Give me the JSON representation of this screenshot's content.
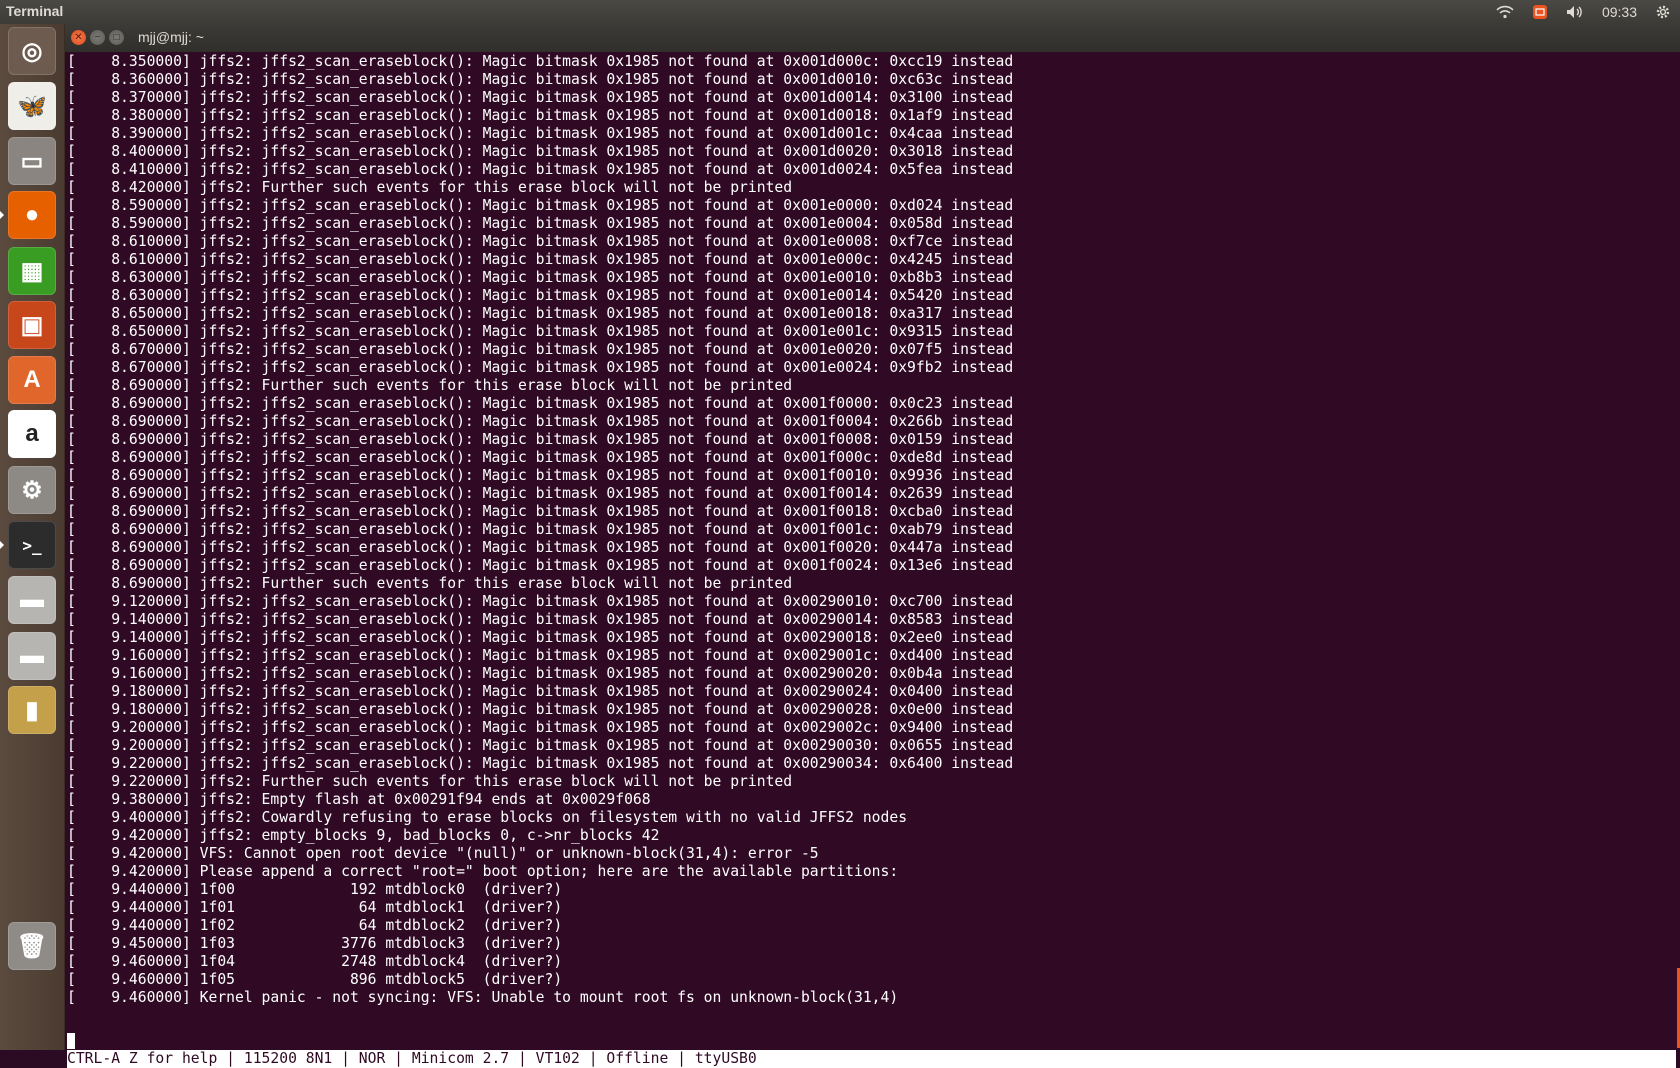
{
  "topbar": {
    "app_title": "Terminal",
    "clock": "09:33"
  },
  "icons": {
    "wifi": "wifi-icon",
    "input_method": "keyboard-indicator-icon",
    "volume": "volume-icon",
    "settings": "gear-icon"
  },
  "colors": {
    "terminal_bg": "#300a24",
    "terminal_fg": "#ffffff",
    "accent": "#e95420",
    "panel": "#3c3b37"
  },
  "launcher": {
    "items": [
      {
        "name": "dash-home",
        "glyph": "◎",
        "color": "#6d5b4f"
      },
      {
        "name": "shotwell",
        "glyph": "🦋",
        "color": "#f0eee9"
      },
      {
        "name": "files",
        "glyph": "▭",
        "color": "#8a8580"
      },
      {
        "name": "firefox",
        "glyph": "●",
        "color": "#e66000"
      },
      {
        "name": "libreoffice-calc",
        "glyph": "▦",
        "color": "#3a9d23"
      },
      {
        "name": "libreoffice-impress",
        "glyph": "▣",
        "color": "#c7471b"
      },
      {
        "name": "ubuntu-software-center",
        "glyph": "A",
        "color": "#e0662b"
      },
      {
        "name": "amazon",
        "glyph": "a",
        "color": "#ffffff"
      },
      {
        "name": "system-settings",
        "glyph": "⚙",
        "color": "#8d8a85"
      },
      {
        "name": "terminal",
        "glyph": ">_",
        "color": "#2c2c2c"
      },
      {
        "name": "drive-1",
        "glyph": "▬",
        "color": "#b7b5b1"
      },
      {
        "name": "drive-2",
        "glyph": "▬",
        "color": "#b7b5b1"
      },
      {
        "name": "sd-card",
        "glyph": "▮",
        "color": "#c5a04a"
      },
      {
        "name": "trash",
        "glyph": "🗑",
        "color": "#8f8c88"
      }
    ]
  },
  "window": {
    "title": "mjj@mjj: ~"
  },
  "terminal": {
    "lines": [
      "[    8.350000] jffs2: jffs2_scan_eraseblock(): Magic bitmask 0x1985 not found at 0x001d000c: 0xcc19 instead",
      "[    8.360000] jffs2: jffs2_scan_eraseblock(): Magic bitmask 0x1985 not found at 0x001d0010: 0xc63c instead",
      "[    8.370000] jffs2: jffs2_scan_eraseblock(): Magic bitmask 0x1985 not found at 0x001d0014: 0x3100 instead",
      "[    8.380000] jffs2: jffs2_scan_eraseblock(): Magic bitmask 0x1985 not found at 0x001d0018: 0x1af9 instead",
      "[    8.390000] jffs2: jffs2_scan_eraseblock(): Magic bitmask 0x1985 not found at 0x001d001c: 0x4caa instead",
      "[    8.400000] jffs2: jffs2_scan_eraseblock(): Magic bitmask 0x1985 not found at 0x001d0020: 0x3018 instead",
      "[    8.410000] jffs2: jffs2_scan_eraseblock(): Magic bitmask 0x1985 not found at 0x001d0024: 0x5fea instead",
      "[    8.420000] jffs2: Further such events for this erase block will not be printed",
      "[    8.590000] jffs2: jffs2_scan_eraseblock(): Magic bitmask 0x1985 not found at 0x001e0000: 0xd024 instead",
      "[    8.590000] jffs2: jffs2_scan_eraseblock(): Magic bitmask 0x1985 not found at 0x001e0004: 0x058d instead",
      "[    8.610000] jffs2: jffs2_scan_eraseblock(): Magic bitmask 0x1985 not found at 0x001e0008: 0xf7ce instead",
      "[    8.610000] jffs2: jffs2_scan_eraseblock(): Magic bitmask 0x1985 not found at 0x001e000c: 0x4245 instead",
      "[    8.630000] jffs2: jffs2_scan_eraseblock(): Magic bitmask 0x1985 not found at 0x001e0010: 0xb8b3 instead",
      "[    8.630000] jffs2: jffs2_scan_eraseblock(): Magic bitmask 0x1985 not found at 0x001e0014: 0x5420 instead",
      "[    8.650000] jffs2: jffs2_scan_eraseblock(): Magic bitmask 0x1985 not found at 0x001e0018: 0xa317 instead",
      "[    8.650000] jffs2: jffs2_scan_eraseblock(): Magic bitmask 0x1985 not found at 0x001e001c: 0x9315 instead",
      "[    8.670000] jffs2: jffs2_scan_eraseblock(): Magic bitmask 0x1985 not found at 0x001e0020: 0x07f5 instead",
      "[    8.670000] jffs2: jffs2_scan_eraseblock(): Magic bitmask 0x1985 not found at 0x001e0024: 0x9fb2 instead",
      "[    8.690000] jffs2: Further such events for this erase block will not be printed",
      "[    8.690000] jffs2: jffs2_scan_eraseblock(): Magic bitmask 0x1985 not found at 0x001f0000: 0x0c23 instead",
      "[    8.690000] jffs2: jffs2_scan_eraseblock(): Magic bitmask 0x1985 not found at 0x001f0004: 0x266b instead",
      "[    8.690000] jffs2: jffs2_scan_eraseblock(): Magic bitmask 0x1985 not found at 0x001f0008: 0x0159 instead",
      "[    8.690000] jffs2: jffs2_scan_eraseblock(): Magic bitmask 0x1985 not found at 0x001f000c: 0xde8d instead",
      "[    8.690000] jffs2: jffs2_scan_eraseblock(): Magic bitmask 0x1985 not found at 0x001f0010: 0x9936 instead",
      "[    8.690000] jffs2: jffs2_scan_eraseblock(): Magic bitmask 0x1985 not found at 0x001f0014: 0x2639 instead",
      "[    8.690000] jffs2: jffs2_scan_eraseblock(): Magic bitmask 0x1985 not found at 0x001f0018: 0xcba0 instead",
      "[    8.690000] jffs2: jffs2_scan_eraseblock(): Magic bitmask 0x1985 not found at 0x001f001c: 0xab79 instead",
      "[    8.690000] jffs2: jffs2_scan_eraseblock(): Magic bitmask 0x1985 not found at 0x001f0020: 0x447a instead",
      "[    8.690000] jffs2: jffs2_scan_eraseblock(): Magic bitmask 0x1985 not found at 0x001f0024: 0x13e6 instead",
      "[    8.690000] jffs2: Further such events for this erase block will not be printed",
      "[    9.120000] jffs2: jffs2_scan_eraseblock(): Magic bitmask 0x1985 not found at 0x00290010: 0xc700 instead",
      "[    9.140000] jffs2: jffs2_scan_eraseblock(): Magic bitmask 0x1985 not found at 0x00290014: 0x8583 instead",
      "[    9.140000] jffs2: jffs2_scan_eraseblock(): Magic bitmask 0x1985 not found at 0x00290018: 0x2ee0 instead",
      "[    9.160000] jffs2: jffs2_scan_eraseblock(): Magic bitmask 0x1985 not found at 0x0029001c: 0xd400 instead",
      "[    9.160000] jffs2: jffs2_scan_eraseblock(): Magic bitmask 0x1985 not found at 0x00290020: 0x0b4a instead",
      "[    9.180000] jffs2: jffs2_scan_eraseblock(): Magic bitmask 0x1985 not found at 0x00290024: 0x0400 instead",
      "[    9.180000] jffs2: jffs2_scan_eraseblock(): Magic bitmask 0x1985 not found at 0x00290028: 0x0e00 instead",
      "[    9.200000] jffs2: jffs2_scan_eraseblock(): Magic bitmask 0x1985 not found at 0x0029002c: 0x9400 instead",
      "[    9.200000] jffs2: jffs2_scan_eraseblock(): Magic bitmask 0x1985 not found at 0x00290030: 0x0655 instead",
      "[    9.220000] jffs2: jffs2_scan_eraseblock(): Magic bitmask 0x1985 not found at 0x00290034: 0x6400 instead",
      "[    9.220000] jffs2: Further such events for this erase block will not be printed",
      "[    9.380000] jffs2: Empty flash at 0x00291f94 ends at 0x0029f068",
      "[    9.400000] jffs2: Cowardly refusing to erase blocks on filesystem with no valid JFFS2 nodes",
      "[    9.420000] jffs2: empty_blocks 9, bad_blocks 0, c->nr_blocks 42",
      "[    9.420000] VFS: Cannot open root device \"(null)\" or unknown-block(31,4): error -5",
      "[    9.420000] Please append a correct \"root=\" boot option; here are the available partitions:",
      "[    9.440000] 1f00             192 mtdblock0  (driver?)",
      "[    9.440000] 1f01              64 mtdblock1  (driver?)",
      "[    9.440000] 1f02              64 mtdblock2  (driver?)",
      "[    9.450000] 1f03            3776 mtdblock3  (driver?)",
      "[    9.460000] 1f04            2748 mtdblock4  (driver?)",
      "[    9.460000] 1f05             896 mtdblock5  (driver?)",
      "[    9.460000] Kernel panic - not syncing: VFS: Unable to mount root fs on unknown-block(31,4)"
    ],
    "status_line": "CTRL-A Z for help | 115200 8N1 | NOR | Minicom 2.7 | VT102 | Offline | ttyUSB0"
  }
}
